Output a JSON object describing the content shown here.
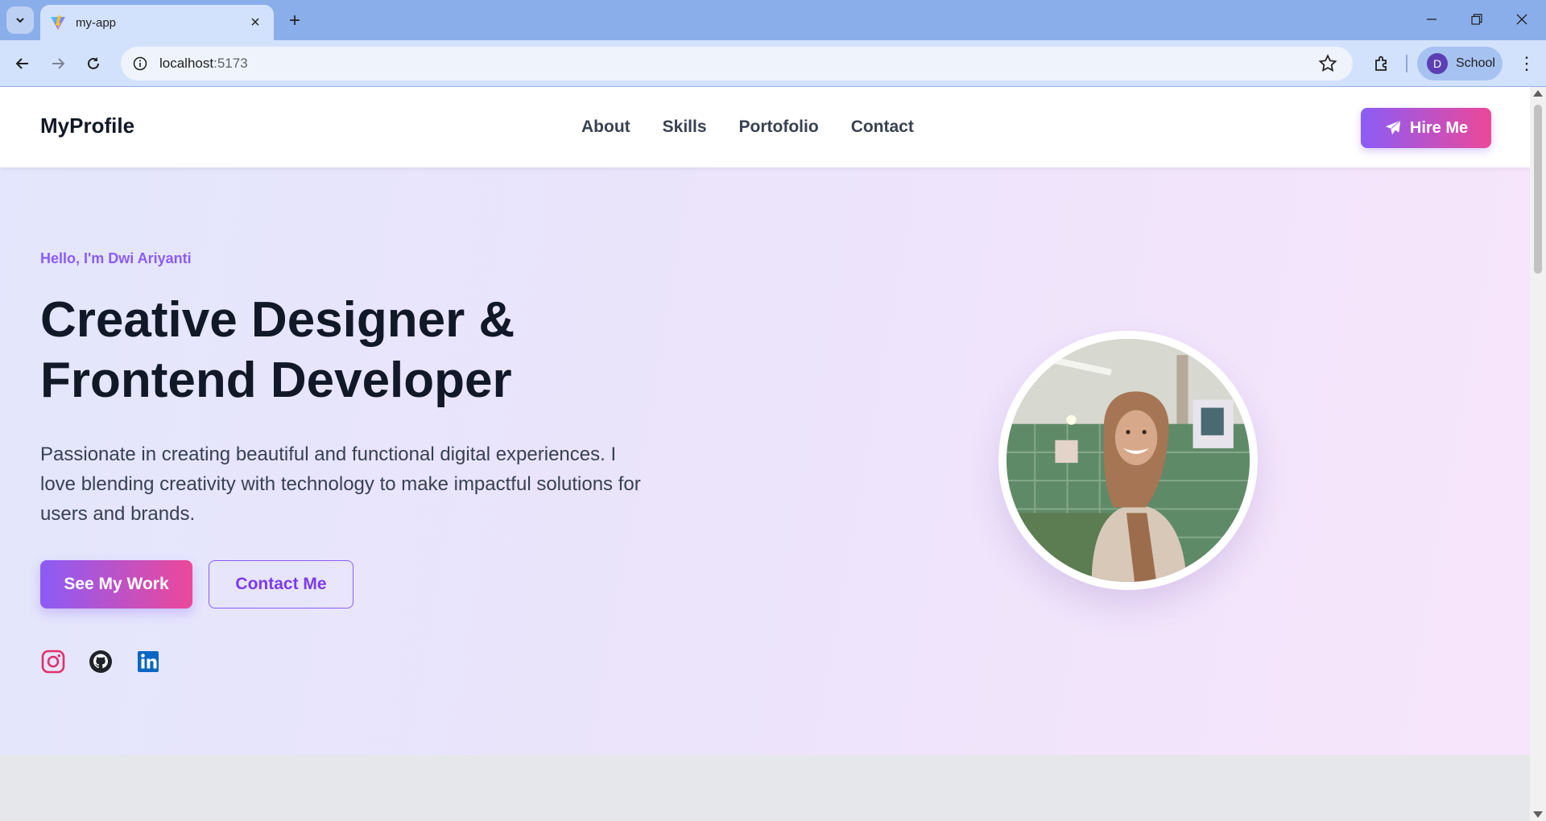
{
  "browser": {
    "tab_title": "my-app",
    "url_host": "localhost",
    "url_port": ":5173",
    "profile_initial": "D",
    "profile_name": "School"
  },
  "site": {
    "brand": "MyProfile",
    "nav": [
      "About",
      "Skills",
      "Portofolio",
      "Contact"
    ],
    "hire_label": "Hire Me"
  },
  "hero": {
    "greeting": "Hello, I'm Dwi Ariyanti",
    "headline_line1": "Creative Designer &",
    "headline_line2": "Frontend Developer",
    "description": "Passionate in creating beautiful and functional digital experiences. I love blending creativity with technology to make impactful solutions for users and brands.",
    "primary_button": "See My Work",
    "secondary_button": "Contact Me",
    "social_icons": [
      "instagram-icon",
      "github-icon",
      "linkedin-icon"
    ]
  },
  "colors": {
    "accent_purple": "#8b5cf6",
    "accent_pink": "#ec4899",
    "instagram": "#e1306c",
    "linkedin": "#0a66c2"
  }
}
